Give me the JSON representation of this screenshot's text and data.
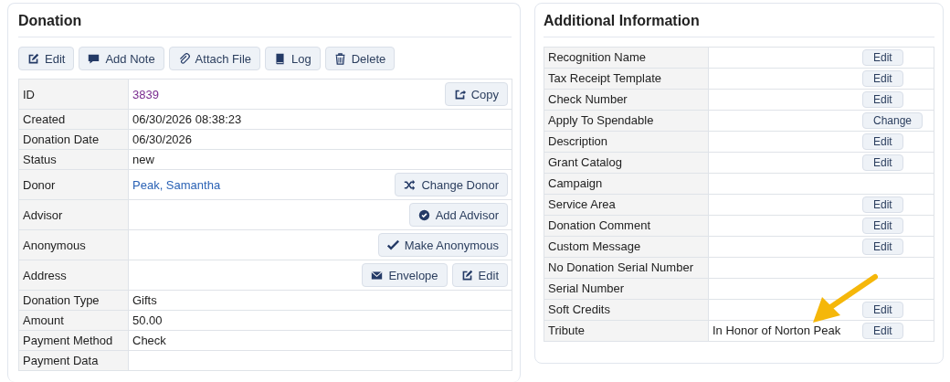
{
  "donation": {
    "title": "Donation",
    "toolbar": [
      {
        "label": "Edit",
        "kind": "edit"
      },
      {
        "label": "Add Note",
        "kind": "note"
      },
      {
        "label": "Attach File",
        "kind": "attach"
      },
      {
        "label": "Log",
        "kind": "log"
      },
      {
        "label": "Delete",
        "kind": "delete"
      }
    ],
    "rows": [
      {
        "label": "ID",
        "value": "3839",
        "kind": "visited",
        "buttons": [
          {
            "label": "Copy",
            "kind": "copy"
          }
        ]
      },
      {
        "label": "Created",
        "value": "06/30/2026 08:38:23",
        "kind": "plain"
      },
      {
        "label": "Donation Date",
        "value": "06/30/2026",
        "kind": "plain"
      },
      {
        "label": "Status",
        "value": "new",
        "kind": "plain"
      },
      {
        "label": "Donor",
        "value": "Peak, Samantha",
        "kind": "link",
        "buttons": [
          {
            "label": "Change Donor",
            "kind": "change"
          }
        ]
      },
      {
        "label": "Advisor",
        "buttons": [
          {
            "label": "Add Advisor",
            "kind": "add"
          }
        ]
      },
      {
        "label": "Anonymous",
        "buttons": [
          {
            "label": "Make Anonymous",
            "kind": "confirm"
          }
        ]
      },
      {
        "label": "Address",
        "buttons": [
          {
            "label": "Envelope",
            "kind": "mail"
          },
          {
            "label": "Edit",
            "kind": "edit"
          }
        ]
      },
      {
        "label": "Donation Type",
        "value": "Gifts",
        "kind": "plain"
      },
      {
        "label": "Amount",
        "value": "50.00",
        "kind": "plain"
      },
      {
        "label": "Payment Method",
        "value": "Check",
        "kind": "plain"
      },
      {
        "label": "Payment Data"
      }
    ]
  },
  "additional": {
    "title": "Additional Information",
    "rows": [
      {
        "label": "Recognition Name",
        "button": "Edit"
      },
      {
        "label": "Tax Receipt Template",
        "button": "Edit"
      },
      {
        "label": "Check Number",
        "button": "Edit"
      },
      {
        "label": "Apply To Spendable",
        "button": "Change"
      },
      {
        "label": "Description",
        "button": "Edit"
      },
      {
        "label": "Grant Catalog",
        "button": "Edit"
      },
      {
        "label": "Campaign"
      },
      {
        "label": "Service Area",
        "button": "Edit"
      },
      {
        "label": "Donation Comment",
        "button": "Edit"
      },
      {
        "label": "Custom Message",
        "button": "Edit"
      },
      {
        "label": "No Donation Serial Number"
      },
      {
        "label": "Serial Number"
      },
      {
        "label": "Soft Credits",
        "button": "Edit"
      },
      {
        "label": "Tribute",
        "value": "In Honor of Norton Peak",
        "button": "Edit"
      }
    ]
  }
}
